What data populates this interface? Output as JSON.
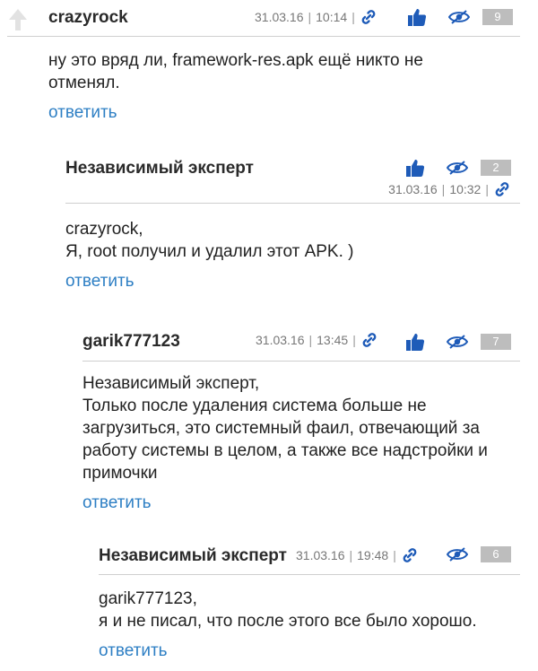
{
  "colors": {
    "accent": "#1e5bb8",
    "link": "#2e7fc4",
    "badge": "#bdbdbd"
  },
  "icons": {
    "upvote": "up-arrow-icon",
    "permalink": "link-icon",
    "like": "thumbs-up-icon",
    "hide": "eye-hidden-icon"
  },
  "comments": [
    {
      "author": "crazyrock",
      "date": "31.03.16",
      "time": "10:14",
      "rating": "9",
      "lines": [
        "ну это вряд ли, framework-res.apk ещё никто не",
        "отменял."
      ],
      "reply": "ответить"
    },
    {
      "author": "Независимый эксперт",
      "date": "31.03.16",
      "time": "10:32",
      "rating": "2",
      "lines": [
        "crazyrock,",
        "Я, root получил и удалил этот APK. )"
      ],
      "reply": "ответить"
    },
    {
      "author": "garik777123",
      "date": "31.03.16",
      "time": "13:45",
      "rating": "7",
      "lines": [
        "Независимый эксперт,",
        "Только после удаления система больше не",
        "загрузиться, это системный фаил, отвечающий за",
        "работу системы в целом, а также все надстройки и",
        "примочки"
      ],
      "reply": "ответить"
    },
    {
      "author": "Независимый эксперт",
      "date": "31.03.16",
      "time": "19:48",
      "rating": "6",
      "lines": [
        "garik777123,",
        "я и не писал, что после этого все было хорошо."
      ],
      "reply": "ответить"
    }
  ]
}
